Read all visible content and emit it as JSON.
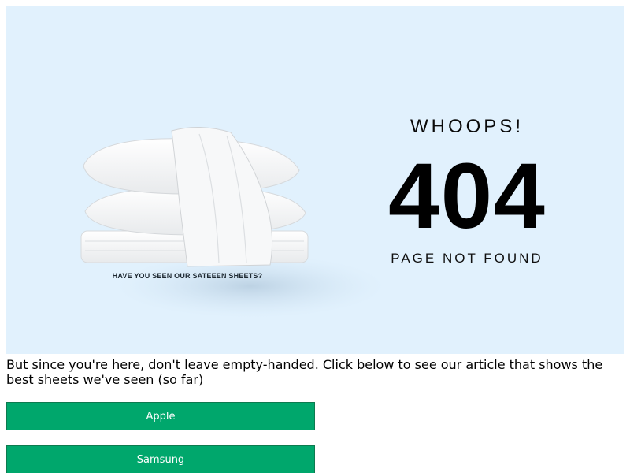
{
  "hero": {
    "image_caption": "HAVE YOU SEEN OUR SATEEEN SHEETS?",
    "heading": "WHOOPS!",
    "code": "404",
    "subheading": "PAGE NOT FOUND",
    "background_color": "#e1f1fd"
  },
  "message": "But since you're here, don't leave empty-handed. Click below to see our article that shows the best sheets we've seen (so far)",
  "buttons": {
    "apple_label": "Apple",
    "samsung_label": "Samsung",
    "color": "#00a76c"
  },
  "icons": {
    "hero_image": "folded-sheets-and-pillows-image"
  }
}
